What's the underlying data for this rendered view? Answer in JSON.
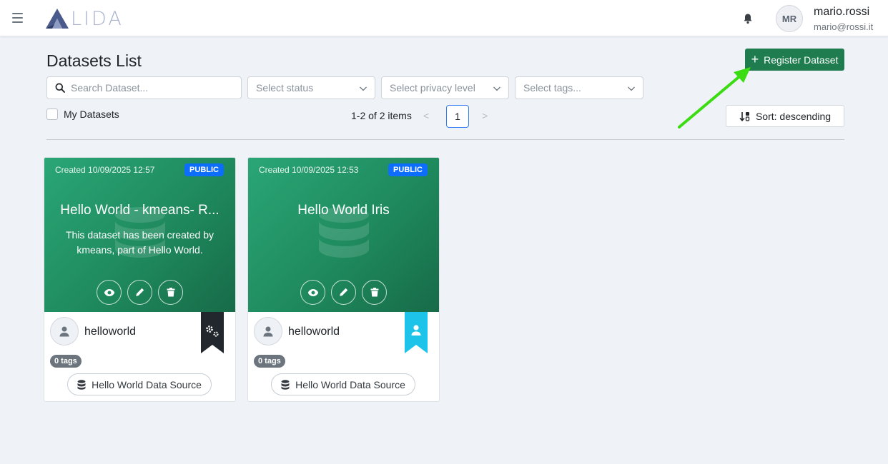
{
  "app": {
    "logo_text": "LIDA",
    "user": {
      "initials": "MR",
      "name": "mario.rossi",
      "email": "mario@rossi.it"
    }
  },
  "header": {
    "title": "Datasets List",
    "register_label": "Register Dataset"
  },
  "filters": {
    "search_placeholder": "Search Dataset...",
    "status_placeholder": "Select status",
    "privacy_placeholder": "Select privacy level",
    "tags_placeholder": "Select tags...",
    "my_datasets_label": "My Datasets",
    "my_datasets_checked": false
  },
  "pagination": {
    "info": "1-2 of 2 items",
    "prev": "<",
    "current_page": "1",
    "next": ">"
  },
  "sort": {
    "label": "Sort: descending"
  },
  "cards": [
    {
      "created": "Created 10/09/2025 12:57",
      "visibility": "PUBLIC",
      "title": "Hello World - kmeans- R...",
      "description": "This dataset has been created by kmeans, part of Hello World.",
      "owner": "helloworld",
      "ribbon_color": "#22272e",
      "ribbon_icon": "gears-icon",
      "tags": "0 tags",
      "source": "Hello World Data Source"
    },
    {
      "created": "Created 10/09/2025 12:53",
      "visibility": "PUBLIC",
      "title": "Hello World Iris",
      "description": "",
      "owner": "helloworld",
      "ribbon_color": "#1ec3ea",
      "ribbon_icon": "user-icon",
      "tags": "0 tags",
      "source": "Hello World Data Source"
    }
  ],
  "colors": {
    "accent": "#1e7c4f",
    "card_gradient_start": "#2aa676",
    "card_gradient_end": "#176b48",
    "badge": "#0d6efd",
    "annotation_arrow": "#3bdc12"
  }
}
